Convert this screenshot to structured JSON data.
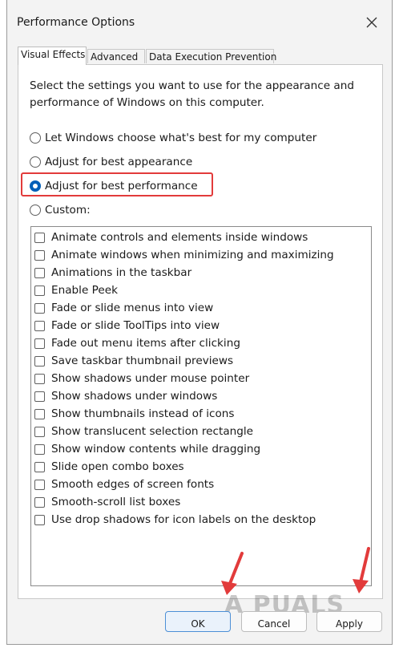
{
  "window": {
    "title": "Performance Options"
  },
  "tabs": [
    {
      "label": "Visual Effects",
      "active": true
    },
    {
      "label": "Advanced",
      "active": false
    },
    {
      "label": "Data Execution Prevention",
      "active": false
    }
  ],
  "panel": {
    "description": "Select the settings you want to use for the appearance and performance of Windows on this computer.",
    "radio_options": [
      {
        "label": "Let Windows choose what's best for my computer",
        "checked": false
      },
      {
        "label": "Adjust for best appearance",
        "checked": false
      },
      {
        "label": "Adjust for best performance",
        "checked": true
      },
      {
        "label": "Custom:",
        "checked": false
      }
    ],
    "effects": [
      "Animate controls and elements inside windows",
      "Animate windows when minimizing and maximizing",
      "Animations in the taskbar",
      "Enable Peek",
      "Fade or slide menus into view",
      "Fade or slide ToolTips into view",
      "Fade out menu items after clicking",
      "Save taskbar thumbnail previews",
      "Show shadows under mouse pointer",
      "Show shadows under windows",
      "Show thumbnails instead of icons",
      "Show translucent selection rectangle",
      "Show window contents while dragging",
      "Slide open combo boxes",
      "Smooth edges of screen fonts",
      "Smooth-scroll list boxes",
      "Use drop shadows for icon labels on the desktop"
    ]
  },
  "buttons": {
    "ok": "OK",
    "cancel": "Cancel",
    "apply": "Apply"
  },
  "watermark": "A  PUALS",
  "colors": {
    "highlight": "#e23b3b",
    "accent": "#005fb8"
  }
}
